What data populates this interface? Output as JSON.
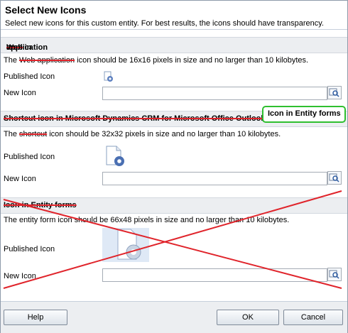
{
  "dialog": {
    "title": "Select New Icons",
    "subtitle": "Select new icons for this custom entity. For best results, the icons should have transparency."
  },
  "section_web": {
    "heading_prefix": "Icon in ",
    "heading_struck": "Web",
    "heading_suffix": " application",
    "desc_prefix": "The ",
    "desc_struck": "Web application",
    "desc_suffix": " icon should be 16x16 pixels in size and no larger than 10 kilobytes.",
    "published_label": "Published Icon",
    "new_label": "New Icon",
    "new_value": ""
  },
  "section_shortcut": {
    "heading": "Shortcut icon in Microsoft Dynamics CRM for Microsoft Office Outlook",
    "desc_prefix": "The ",
    "desc_struck": "shortcut",
    "desc_suffix": " icon should be 32x32 pixels in size and no larger than 10 kilobytes.",
    "published_label": "Published Icon",
    "new_label": "New Icon",
    "new_value": ""
  },
  "section_entity": {
    "heading": "Icon in Entity forms",
    "desc": "The entity form icon should be 66x48 pixels in size and no larger than 10 kilobytes.",
    "published_label": "Published Icon",
    "new_label": "New Icon",
    "new_value": ""
  },
  "callout": {
    "text": "Icon in Entity forms"
  },
  "footer": {
    "help": "Help",
    "ok": "OK",
    "cancel": "Cancel"
  },
  "colors": {
    "strike": "#e0242b",
    "callout_border": "#2fbf2f",
    "section_bg": "#eceef1"
  },
  "icons": [
    "gear-icon",
    "document-gear-icon",
    "browse-icon"
  ]
}
